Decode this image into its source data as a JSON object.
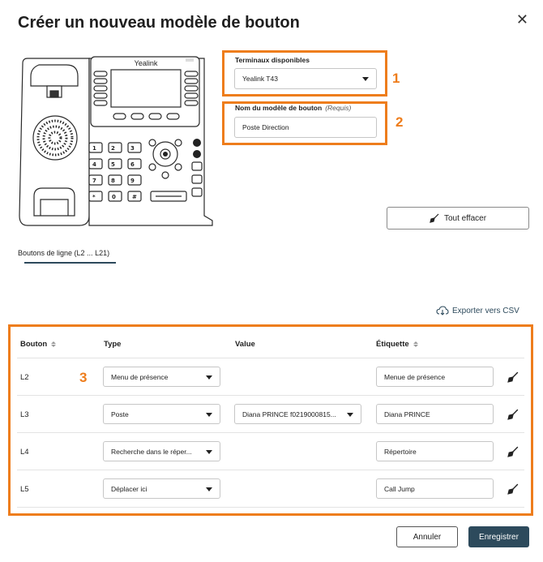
{
  "dialog": {
    "title": "Créer un nouveau modèle de bouton",
    "close_symbol": "✕"
  },
  "phone": {
    "brand": "Yealink"
  },
  "annotations": {
    "n1": "1",
    "n2": "2",
    "n3": "3",
    "color": "#ee7d1c"
  },
  "terminals": {
    "label": "Terminaux disponibles",
    "value": "Yealink T43"
  },
  "model_name": {
    "label": "Nom du modèle de bouton",
    "required": "(Requis)",
    "value": "Poste Direction"
  },
  "clear_all": {
    "label": "Tout effacer",
    "icon": "broom-icon"
  },
  "tabs": [
    {
      "label": "Boutons de ligne (L2 ... L21)"
    }
  ],
  "export": {
    "label": "Exporter vers CSV",
    "icon": "cloud-download-icon"
  },
  "table": {
    "headers": {
      "button": "Bouton",
      "type": "Type",
      "value": "Value",
      "label": "Étiquette"
    },
    "rows": [
      {
        "id": "L2",
        "type": "Menu de présence",
        "value": "",
        "label": "Menue de présence"
      },
      {
        "id": "L3",
        "type": "Poste",
        "value": "Diana PRINCE f0219000815...",
        "label": "Diana PRINCE"
      },
      {
        "id": "L4",
        "type": "Recherche dans le réper...",
        "value": "",
        "label": "Répertoire"
      },
      {
        "id": "L5",
        "type": "Déplacer ici",
        "value": "",
        "label": "Call Jump"
      }
    ]
  },
  "footer": {
    "cancel": "Annuler",
    "save": "Enregistrer"
  },
  "colors": {
    "accent": "#2d4a5c",
    "highlight": "#ee7d1c"
  }
}
